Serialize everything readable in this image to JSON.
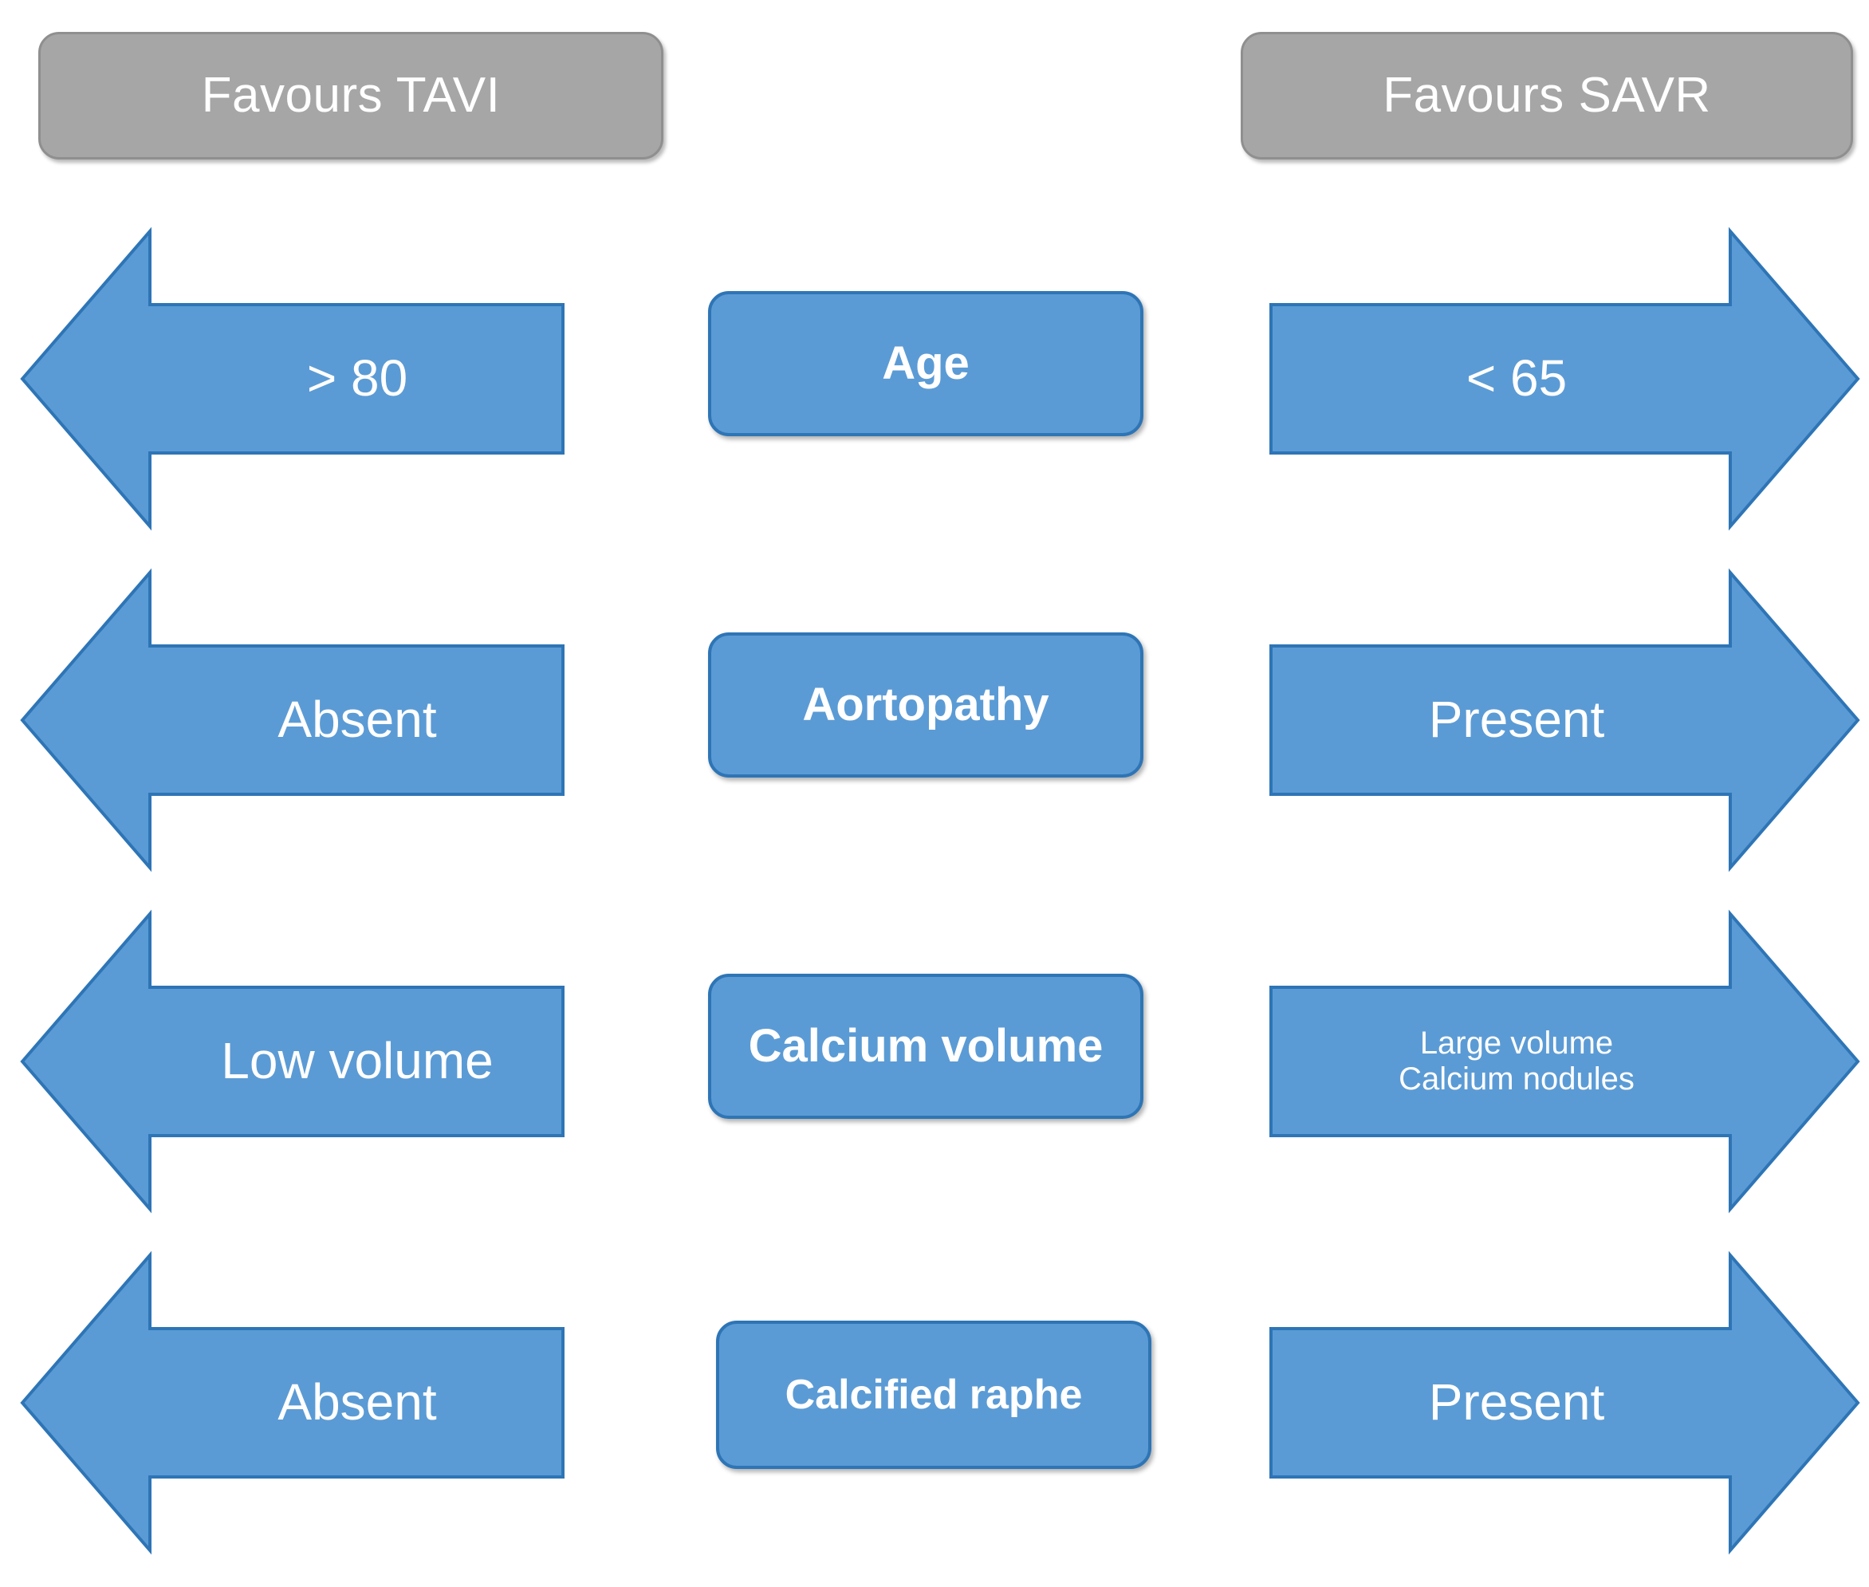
{
  "headers": {
    "left": {
      "label": "Favours TAVI",
      "direction": "left"
    },
    "right": {
      "label": "Favours SAVR",
      "direction": "right"
    }
  },
  "colors": {
    "arrow_fill": "#5B9BD5",
    "arrow_border": "#2E75B6",
    "header_fill": "#A6A6A6",
    "header_border": "#8F8F8F",
    "text": "#FFFFFF",
    "background": "#FFFFFF"
  },
  "rows": [
    {
      "criterion": "Age",
      "left": {
        "lines": [
          "> 80"
        ],
        "size": "large"
      },
      "right": {
        "lines": [
          "< 65"
        ],
        "size": "large"
      }
    },
    {
      "criterion": "Aortopathy",
      "left": {
        "lines": [
          "Absent"
        ],
        "size": "large"
      },
      "right": {
        "lines": [
          "Present"
        ],
        "size": "large"
      }
    },
    {
      "criterion": "Calcium volume",
      "left": {
        "lines": [
          "Low volume"
        ],
        "size": "large"
      },
      "right": {
        "lines": [
          "Large volume",
          "Calcium nodules"
        ],
        "size": "small"
      }
    },
    {
      "criterion": "Calcified raphe",
      "left": {
        "lines": [
          "Absent"
        ],
        "size": "large"
      },
      "right": {
        "lines": [
          "Present"
        ],
        "size": "large"
      }
    }
  ]
}
